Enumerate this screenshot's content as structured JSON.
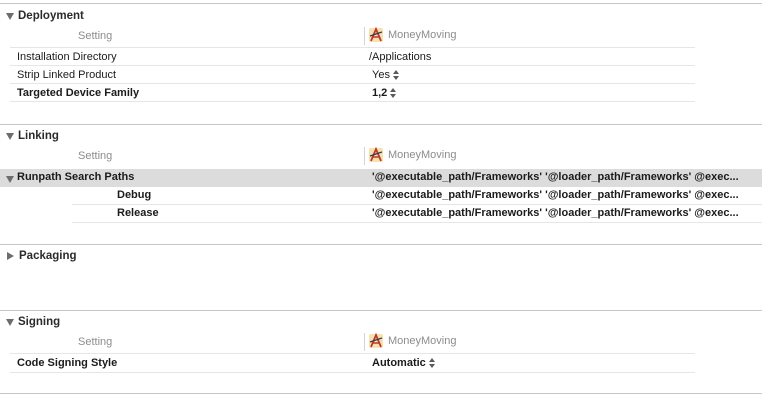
{
  "column_headers": {
    "setting": "Setting",
    "target": "MoneyMoving",
    "target_icon": "xcode-app-icon"
  },
  "deployment": {
    "title": "Deployment",
    "rows": [
      {
        "name": "Installation Directory",
        "value": "/Applications"
      },
      {
        "name": "Strip Linked Product",
        "value": "Yes"
      },
      {
        "name": "Targeted Device Family",
        "value": "1,2"
      }
    ]
  },
  "linking": {
    "title": "Linking",
    "rows": [
      {
        "name": "Runpath Search Paths",
        "value": "'@executable_path/Frameworks' '@loader_path/Frameworks' @exec..."
      },
      {
        "name": "Debug",
        "value": "'@executable_path/Frameworks' '@loader_path/Frameworks' @exec..."
      },
      {
        "name": "Release",
        "value": "'@executable_path/Frameworks' '@loader_path/Frameworks' @exec..."
      }
    ]
  },
  "packaging": {
    "title": "Packaging"
  },
  "signing": {
    "title": "Signing",
    "rows": [
      {
        "name": "Code Signing Style",
        "value": "Automatic"
      }
    ]
  }
}
